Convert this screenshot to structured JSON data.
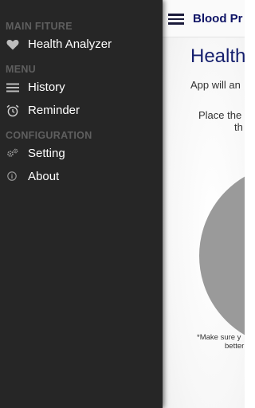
{
  "drawer": {
    "sections": [
      {
        "header": "MAIN FITURE",
        "items": [
          {
            "label": "Health Analyzer",
            "icon": "heart-icon"
          }
        ]
      },
      {
        "header": "MENU",
        "items": [
          {
            "label": "History",
            "icon": "menu-lines-icon"
          },
          {
            "label": "Reminder",
            "icon": "alarm-clock-icon"
          }
        ]
      },
      {
        "header": "CONFIGURATION",
        "items": [
          {
            "label": "Setting",
            "icon": "gears-icon"
          },
          {
            "label": "About",
            "icon": "info-icon"
          }
        ]
      }
    ],
    "background": "#262626",
    "header_color": "#5f5f5f"
  },
  "appbar": {
    "title": "Blood Pr",
    "title_color": "#0f1466"
  },
  "main": {
    "heading": "Health",
    "intro": "App will an",
    "instruction_line1": "Place the",
    "instruction_line2": "th",
    "note_line1": "*Make sure y",
    "note_line2": "better",
    "ring_color": "#9a9a9a",
    "heading_color": "#16206e"
  }
}
